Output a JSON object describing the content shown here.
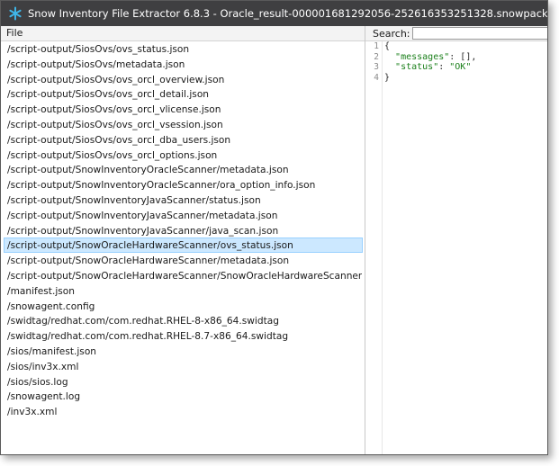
{
  "window": {
    "title": "Snow Inventory File Extractor 6.8.3 - Oracle_result-000001681292056-252616353251328.snowpack",
    "icon": "snowflake-icon",
    "titlebar_color": "#3f3f41",
    "icon_color": "#3fb6e8"
  },
  "file_panel": {
    "header": "File",
    "selected_index": 13,
    "selected_color": "#cce8ff",
    "items": [
      "/script-output/SiosOvs/ovs_status.json",
      "/script-output/SiosOvs/metadata.json",
      "/script-output/SiosOvs/ovs_orcl_overview.json",
      "/script-output/SiosOvs/ovs_orcl_detail.json",
      "/script-output/SiosOvs/ovs_orcl_vlicense.json",
      "/script-output/SiosOvs/ovs_orcl_vsession.json",
      "/script-output/SiosOvs/ovs_orcl_dba_users.json",
      "/script-output/SiosOvs/ovs_orcl_options.json",
      "/script-output/SnowInventoryOracleScanner/metadata.json",
      "/script-output/SnowInventoryOracleScanner/ora_option_info.json",
      "/script-output/SnowInventoryJavaScanner/status.json",
      "/script-output/SnowInventoryJavaScanner/metadata.json",
      "/script-output/SnowInventoryJavaScanner/java_scan.json",
      "/script-output/SnowOracleHardwareScanner/ovs_status.json",
      "/script-output/SnowOracleHardwareScanner/metadata.json",
      "/script-output/SnowOracleHardwareScanner/SnowOracleHardwareScanner.json",
      "/manifest.json",
      "/snowagent.config",
      "/swidtag/redhat.com/com.redhat.RHEL-8-x86_64.swidtag",
      "/swidtag/redhat.com/com.redhat.RHEL-8.7-x86_64.swidtag",
      "/sios/manifest.json",
      "/sios/inv3x.xml",
      "/sios/sios.log",
      "/snowagent.log",
      "/inv3x.xml"
    ]
  },
  "content_panel": {
    "search_label": "Search:",
    "search_value": "",
    "lines": [
      {
        "number": "1",
        "text": "{"
      },
      {
        "number": "2",
        "text": "  \"messages\": [],"
      },
      {
        "number": "3",
        "text": "  \"status\": \"OK\""
      },
      {
        "number": "4",
        "text": "}"
      }
    ]
  }
}
